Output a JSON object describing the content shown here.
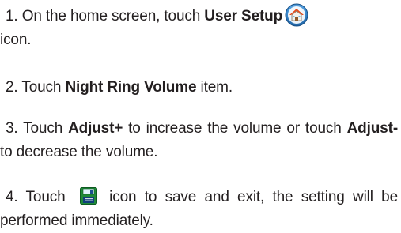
{
  "steps": [
    {
      "number": "1.",
      "pre": "On the home screen, touch ",
      "bold": "User Setup",
      "post": "icon.",
      "icon": "home-icon"
    },
    {
      "number": "2.",
      "pre": "Touch ",
      "bold": "Night Ring Volume",
      "post": " item."
    },
    {
      "number": "3.",
      "pre": "Touch ",
      "bold": "Adjust+",
      "mid": " to increase the volume or touch ",
      "bold2": "Adjust-",
      "post": " to decrease the volume."
    },
    {
      "number": "4.",
      "pre": "Touch ",
      "post": " icon to save and exit, the setting will be performed immediately.",
      "icon": "save-icon"
    }
  ],
  "colors": {
    "text": "#231f20",
    "home_icon_ring": "#2f7fc4",
    "home_icon_roof": "#e64a19",
    "save_icon_bg": "#1f8a3a"
  }
}
